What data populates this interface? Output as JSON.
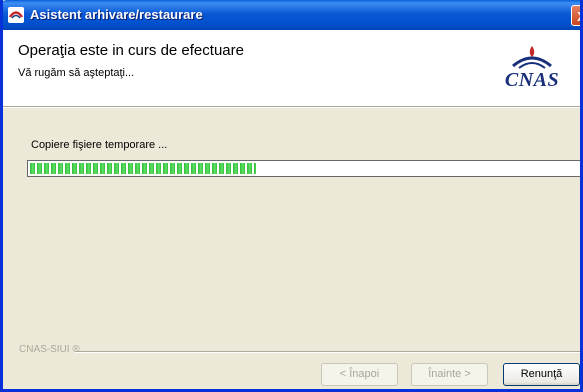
{
  "window": {
    "title": "Asistent arhivare/restaurare",
    "close_glyph": "X"
  },
  "header": {
    "title": "Operaţia este in curs de efectuare",
    "subtitle": "Vă rugăm să aşteptaţi...",
    "logo_text": "CNAS"
  },
  "progress": {
    "label": "Copiere fişiere temporare ...",
    "fraction": 0.41,
    "color": "#2fbe36"
  },
  "footer": {
    "brand": "CNAS-SIUI ®"
  },
  "buttons": {
    "back": "< Înapoi",
    "next": "Înainte >",
    "cancel": "Renunţă"
  },
  "colors": {
    "titlebar": "#0c59d6",
    "window_border": "#0831d9",
    "dialog_bg": "#ece9d8"
  }
}
